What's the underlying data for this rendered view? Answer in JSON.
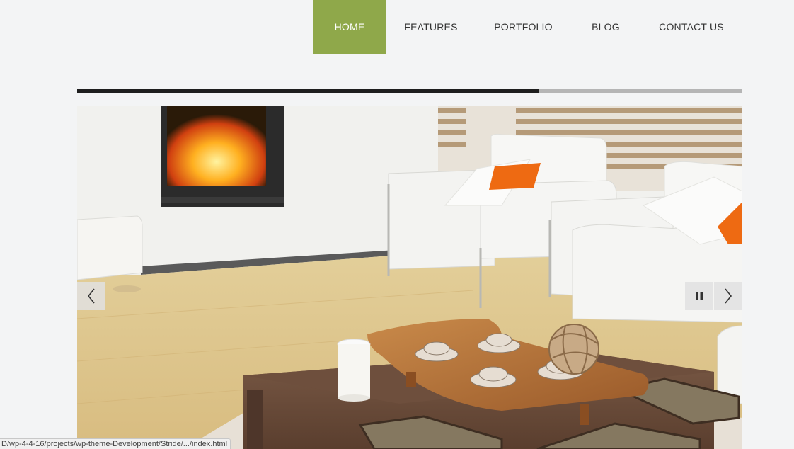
{
  "nav": {
    "items": [
      {
        "label": "HOME"
      },
      {
        "label": "FEATURES"
      },
      {
        "label": "PORTFOLIO"
      },
      {
        "label": "BLOG"
      },
      {
        "label": "CONTACT US"
      }
    ],
    "active_color": "#8fa84a"
  },
  "slider": {
    "progress_fraction": 0.695,
    "image_description": "living-room",
    "prev_icon": "chevron-left-icon",
    "pause_icon": "pause-icon",
    "next_icon": "chevron-right-icon"
  },
  "statusbar": {
    "url": "D/wp-4-4-16/projects/wp-theme-Development/Stride/.../index.html"
  }
}
